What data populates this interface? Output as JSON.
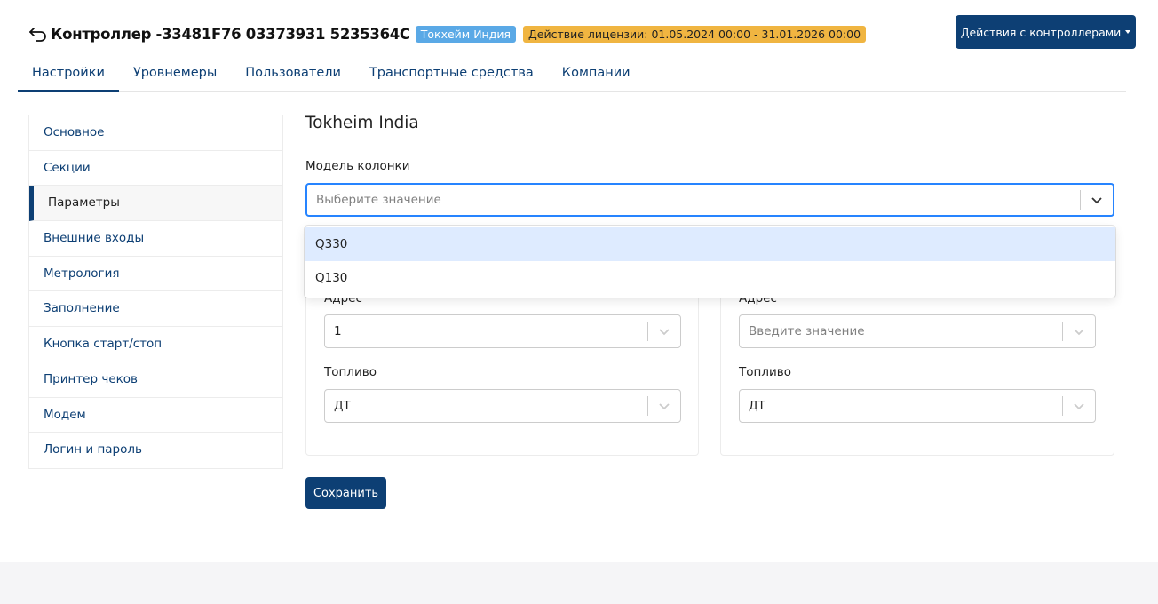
{
  "header": {
    "title": "Контроллер -33481F76 03373931 5235364C",
    "company_badge": "Токхейм Индия",
    "license_badge": "Действие лицензии: 01.05.2024 00:00 - 31.01.2026 00:00",
    "actions_button": "Действия с контроллерами"
  },
  "tabs": [
    {
      "label": "Настройки",
      "active": true
    },
    {
      "label": "Уровнемеры"
    },
    {
      "label": "Пользователи"
    },
    {
      "label": "Транспортные средства"
    },
    {
      "label": "Компании"
    }
  ],
  "sidebar": {
    "items": [
      {
        "label": "Основное"
      },
      {
        "label": "Секции"
      },
      {
        "label": "Параметры",
        "active": true
      },
      {
        "label": "Внешние входы"
      },
      {
        "label": "Метрология"
      },
      {
        "label": "Заполнение"
      },
      {
        "label": "Кнопка старт/стоп"
      },
      {
        "label": "Принтер чеков"
      },
      {
        "label": "Модем"
      },
      {
        "label": "Логин и пароль"
      }
    ]
  },
  "main": {
    "title": "Tokheim India",
    "model_label": "Модель колонки",
    "model_placeholder": "Выберите значение",
    "model_options": [
      "Q330",
      "Q130"
    ],
    "panels": [
      {
        "address_label": "Адрес",
        "address_value": "1",
        "fuel_label": "Топливо",
        "fuel_value": "ДТ"
      },
      {
        "address_label": "Адрес",
        "address_placeholder": "Введите значение",
        "fuel_label": "Топливо",
        "fuel_value": "ДТ"
      }
    ],
    "save_button": "Сохранить"
  },
  "colors": {
    "primary": "#0d3f74",
    "company_badge": "#5aa9e6",
    "license_badge": "#f0b541",
    "focus": "#2684ff",
    "option_hover": "#deebff"
  }
}
